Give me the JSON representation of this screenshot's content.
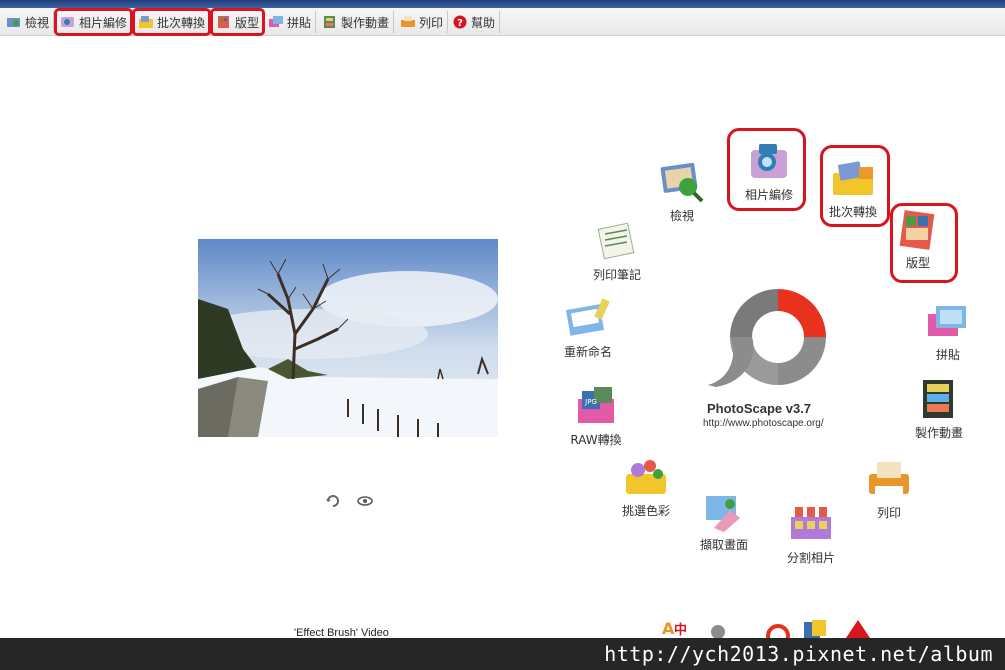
{
  "tabs": [
    {
      "label": "檢視",
      "icon": "viewer-icon",
      "highlighted": false
    },
    {
      "label": "相片編修",
      "icon": "photo-edit-icon",
      "highlighted": true
    },
    {
      "label": "批次轉換",
      "icon": "batch-icon",
      "highlighted": true
    },
    {
      "label": "版型",
      "icon": "page-layout-icon",
      "highlighted": true
    },
    {
      "label": "拼貼",
      "icon": "combine-icon",
      "highlighted": false
    },
    {
      "label": "製作動畫",
      "icon": "animated-gif-icon",
      "highlighted": false
    },
    {
      "label": "列印",
      "icon": "print-icon",
      "highlighted": false
    },
    {
      "label": "幫助",
      "icon": "help-icon",
      "highlighted": false
    }
  ],
  "menu": [
    {
      "label": "檢視",
      "icon": "viewer-icon"
    },
    {
      "label": "相片編修",
      "icon": "photo-edit-icon",
      "highlighted": true
    },
    {
      "label": "批次轉換",
      "icon": "batch-icon",
      "highlighted": true
    },
    {
      "label": "版型",
      "icon": "page-layout-icon",
      "highlighted": true
    },
    {
      "label": "拼貼",
      "icon": "combine-icon"
    },
    {
      "label": "製作動畫",
      "icon": "animated-gif-icon"
    },
    {
      "label": "列印",
      "icon": "print-icon"
    },
    {
      "label": "分割相片",
      "icon": "splitter-icon"
    },
    {
      "label": "擷取畫面",
      "icon": "screen-capture-icon"
    },
    {
      "label": "挑選色彩",
      "icon": "color-picker-icon"
    },
    {
      "label": "RAW轉換",
      "icon": "raw-converter-icon"
    },
    {
      "label": "重新命名",
      "icon": "rename-icon"
    },
    {
      "label": "列印筆記",
      "icon": "paper-print-icon"
    }
  ],
  "logo": {
    "title": "PhotoScape v3.7",
    "url": "http://www.photoscape.org/"
  },
  "preview": {
    "caption": "'Effect Brush' Video"
  },
  "watermark": "http://ych2013.pixnet.net/album",
  "colors": {
    "highlight": "#d8141e",
    "logo_red": "#e8321e",
    "logo_gray": "#8c8c8c"
  }
}
